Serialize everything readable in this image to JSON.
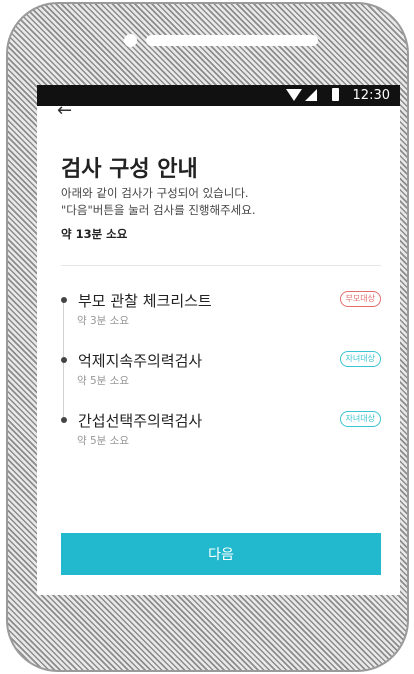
{
  "status_bar": {
    "time": "12:30"
  },
  "header": {
    "back_icon": "arrow-back-icon",
    "title": "검사 구성 안내"
  },
  "intro": {
    "description": "아래와 같이 검사가 구성되어 있습니다.\n\"다음\"버튼을 눌러 검사를 진행해주세요.",
    "total_time": "약 13분 소요"
  },
  "tests": [
    {
      "name": "부모 관찰 체크리스트",
      "time": "약 3분 소요",
      "badge": "부모대상",
      "badge_color": "#e36d6d"
    },
    {
      "name": "억제지속주의력검사",
      "time": "약 5분 소요",
      "badge": "자녀대상",
      "badge_color": "#3cc4d3"
    },
    {
      "name": "간섭선택주의력검사",
      "time": "약 5분 소요",
      "badge": "자녀대상",
      "badge_color": "#3cc4d3"
    }
  ],
  "footer": {
    "next_label": "다음",
    "accent": "#22b9cf"
  }
}
